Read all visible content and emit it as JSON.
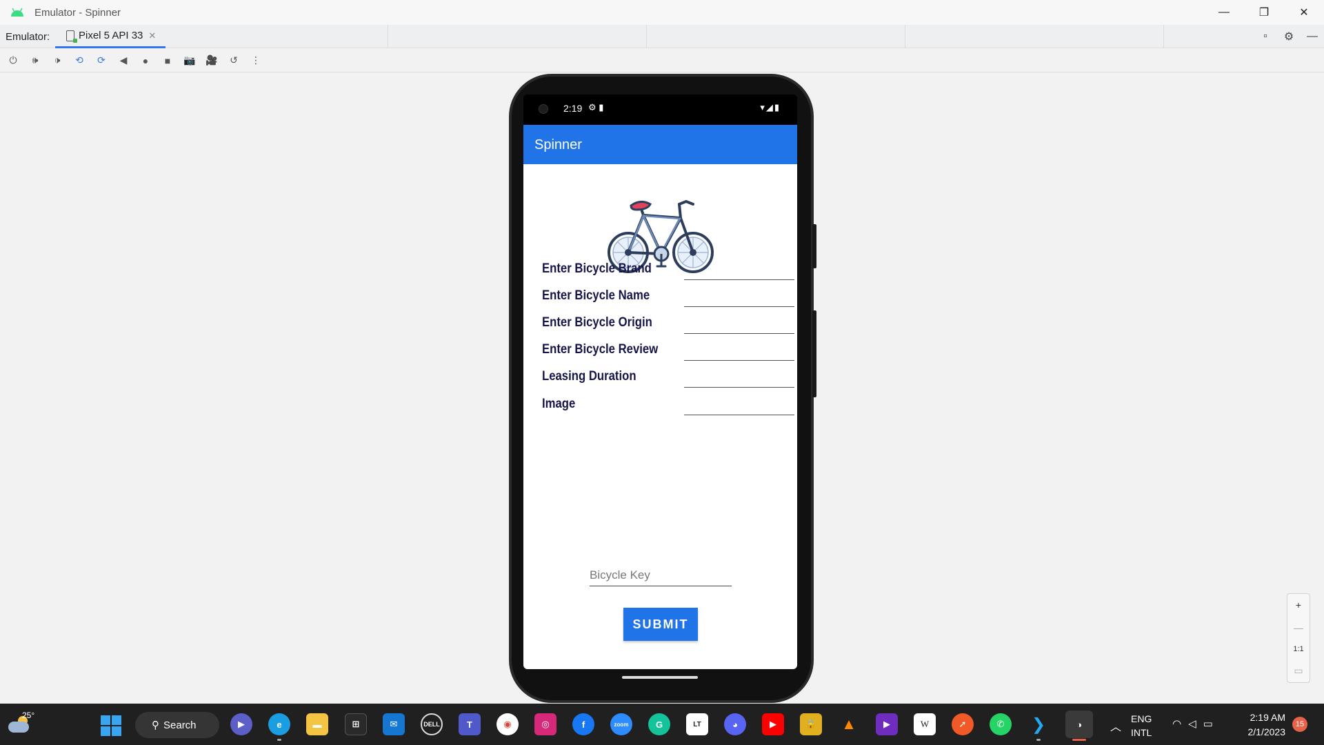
{
  "window": {
    "title": "Emulator - Spinner",
    "controls": [
      "minimize-icon",
      "restore-icon",
      "close-icon"
    ]
  },
  "tabbar": {
    "label": "Emulator:",
    "active_tab": "Pixel 5 API 33",
    "right_icons": [
      "dock-icon",
      "gear-icon",
      "minus-icon"
    ]
  },
  "toolbar": {
    "icons": [
      "power-icon",
      "volume-up-icon",
      "volume-down-icon",
      "rotate-left-icon",
      "rotate-right-icon",
      "back-icon",
      "home-icon",
      "overview-icon",
      "camera-icon",
      "video-icon",
      "snapshot-icon",
      "more-icon"
    ]
  },
  "device": {
    "status_time": "2:19",
    "app_title": "Spinner",
    "form_fields": [
      {
        "label": "Enter Bicycle Brand",
        "value": ""
      },
      {
        "label": "Enter Bicycle Name",
        "value": ""
      },
      {
        "label": "Enter Bicycle Origin",
        "value": ""
      },
      {
        "label": "Enter Bicycle Review",
        "value": ""
      },
      {
        "label": "Leasing Duration",
        "value": ""
      },
      {
        "label": "Image",
        "value": ""
      }
    ],
    "key_input_placeholder": "Bicycle Key",
    "submit_label": "SUBMIT"
  },
  "zoom": {
    "plus": "+",
    "minus": "—",
    "one_to_one": "1:1"
  },
  "taskbar": {
    "weather_temp": "25°",
    "search_label": "Search",
    "ime_line1": "ENG",
    "ime_line2": "INTL",
    "time": "2:19 AM",
    "date": "2/1/2023",
    "notification_count": "15"
  },
  "colors": {
    "app_bar": "#2174e8",
    "submit": "#2174e8",
    "form_label": "#15154a",
    "tab_accent": "#3574f0"
  }
}
